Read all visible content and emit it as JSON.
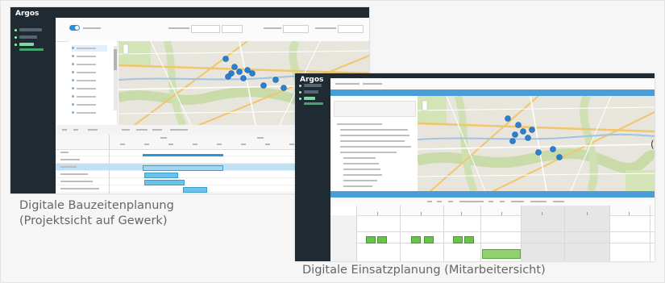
{
  "app": {
    "brand": "Argos"
  },
  "captions": {
    "left_line1": "Digitale Bauzeitenplanung",
    "left_line2": "(Projektsicht auf Gewerk)",
    "right": "Digitale Einsatzplanung (Mitarbeitersicht)"
  },
  "colors": {
    "sidebar": "#1f2a33",
    "accent_blue": "#4a9ed7",
    "gantt_bar": "#6cc1e8",
    "schedule_green": "#69c24a",
    "schedule_cyan": "#5fd6e6",
    "map_marker": "#2b7fd0"
  }
}
